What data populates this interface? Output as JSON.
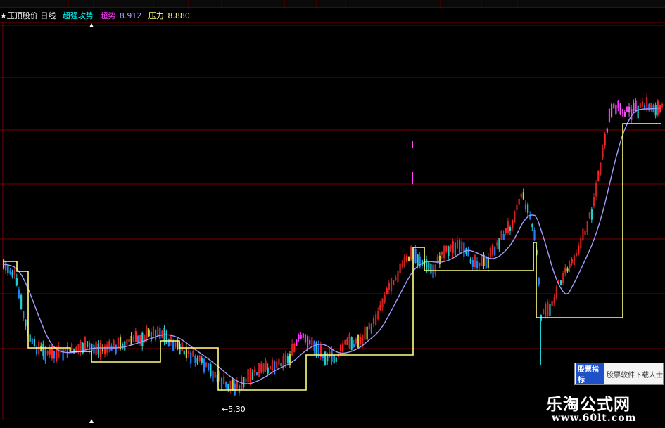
{
  "toolbar": {
    "buttons": [
      "",
      "",
      "",
      "",
      "",
      "",
      "",
      "",
      "",
      "",
      "",
      "",
      "",
      "",
      "",
      ""
    ]
  },
  "infobar": {
    "title": "★压顶股价 日线",
    "tag": "超强攻势",
    "support_label": "超势",
    "support_value": "8.912",
    "pressure_label": "压力",
    "pressure_value": "8.880"
  },
  "chart_data": {
    "type": "candlestick",
    "ylim": [
      5.0,
      10.0
    ],
    "grid": true,
    "low_annotation": "←5.30",
    "candle_colors": [
      "#ff2020",
      "#cc2222",
      "#d0d040",
      "#20d0d0",
      "#2080ff",
      "#ff30ff",
      "#e060e0"
    ],
    "ma_color": "#a39cff",
    "stop_color": "#ffff80",
    "n_candles": 300
  },
  "watermark": {
    "tag": "股票指标",
    "text": "股票软件下载人士"
  },
  "site": {
    "title": "乐淘公式网",
    "url": "www.60lt.com"
  },
  "bottom": {
    "text": ""
  }
}
